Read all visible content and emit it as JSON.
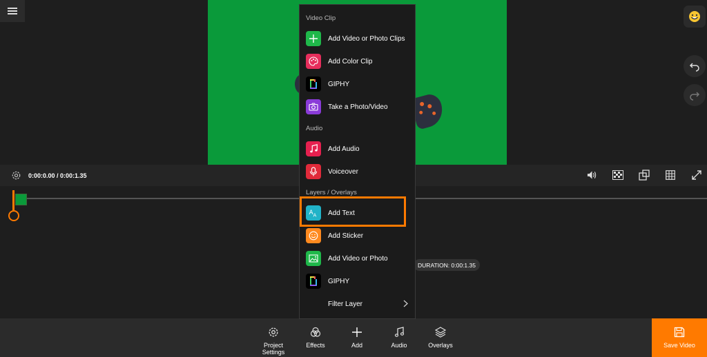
{
  "playback": {
    "timecode": "0:00:0.00 / 0:00:1.35"
  },
  "timeline": {
    "duration": "DURATION: 0:00:1.35"
  },
  "add_menu": {
    "sections": [
      {
        "title": "Video Clip",
        "items": [
          {
            "label": "Add Video or Photo Clips",
            "icon": "plus-icon",
            "color": "#1fb84a"
          },
          {
            "label": "Add Color Clip",
            "icon": "palette-icon",
            "color": "#e62e5c"
          },
          {
            "label": "GIPHY",
            "icon": "giphy-icon",
            "color": "#000000"
          },
          {
            "label": "Take a Photo/Video",
            "icon": "camera-icon",
            "color": "#8a3bd8"
          }
        ]
      },
      {
        "title": "Audio",
        "items": [
          {
            "label": "Add Audio",
            "icon": "music-note-icon",
            "color": "#e6204f"
          },
          {
            "label": "Voiceover",
            "icon": "microphone-icon",
            "color": "#e02a3a"
          }
        ]
      },
      {
        "title": "Layers / Overlays",
        "items": [
          {
            "label": "Add Text",
            "icon": "text-icon",
            "color": "#21b3c8"
          },
          {
            "label": "Add Sticker",
            "icon": "smiley-icon",
            "color": "#ff8a1f"
          },
          {
            "label": "Add Video or Photo",
            "icon": "image-icon",
            "color": "#1fb84a"
          },
          {
            "label": "GIPHY",
            "icon": "giphy-icon",
            "color": "#000000"
          },
          {
            "label": "Filter Layer",
            "icon": "chevron-right-icon",
            "color": ""
          }
        ]
      }
    ]
  },
  "toolbar": {
    "project_settings": "Project Settings",
    "effects": "Effects",
    "add": "Add",
    "audio": "Audio",
    "overlays": "Overlays",
    "save_video": "Save Video"
  },
  "colors": {
    "accent": "#ff7a00",
    "canvas": "#0a9a3a"
  }
}
